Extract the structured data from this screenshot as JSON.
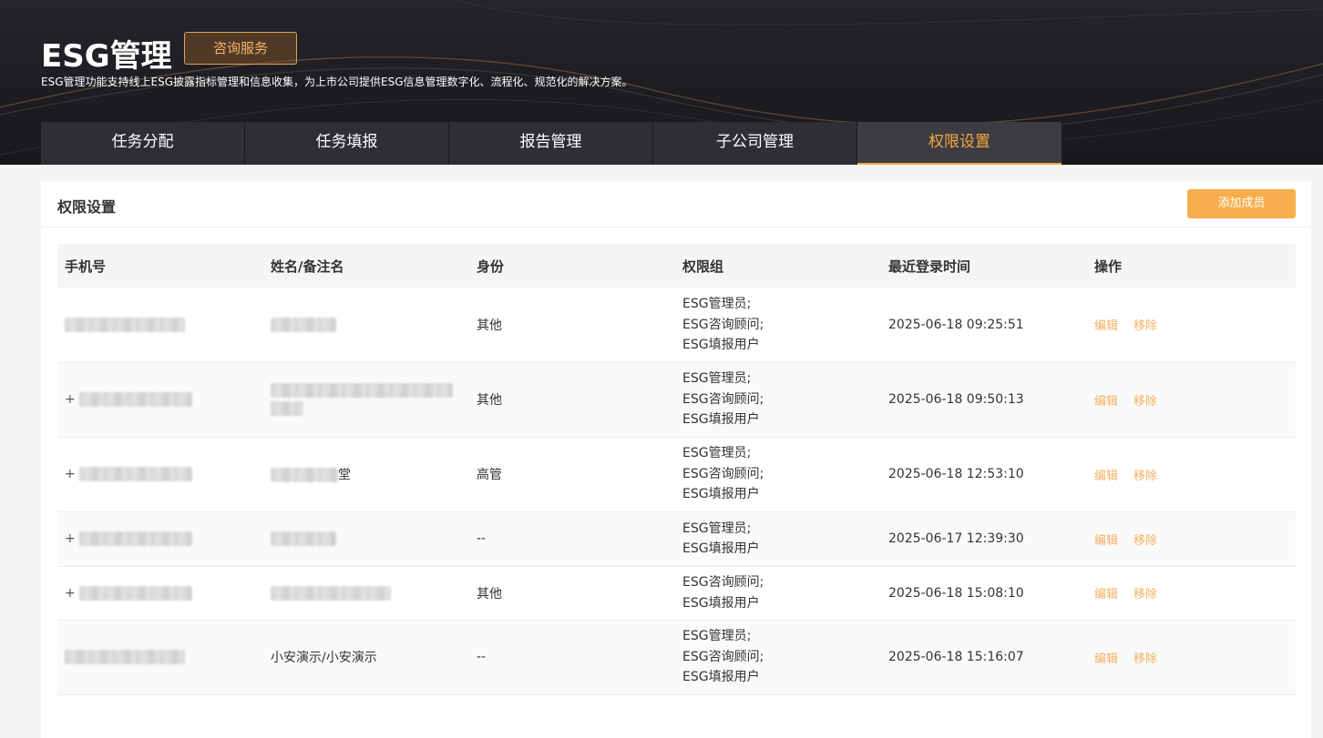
{
  "header": {
    "title": "ESG管理",
    "consult_label": "咨询服务",
    "description": "ESG管理功能支持线上ESG披露指标管理和信息收集，为上市公司提供ESG信息管理数字化、流程化、规范化的解决方案。"
  },
  "tabs": [
    {
      "label": "任务分配",
      "active": false
    },
    {
      "label": "任务填报",
      "active": false
    },
    {
      "label": "报告管理",
      "active": false
    },
    {
      "label": "子公司管理",
      "active": false
    },
    {
      "label": "权限设置",
      "active": true
    }
  ],
  "panel": {
    "title": "权限设置",
    "add_label": "添加成员"
  },
  "table": {
    "columns": [
      "手机号",
      "姓名/备注名",
      "身份",
      "权限组",
      "最近登录时间",
      "操作"
    ],
    "rows": [
      {
        "phone_prefix": "",
        "name": "",
        "name_suffix": "",
        "role": "其他",
        "perms": [
          "ESG管理员;",
          "ESG咨询顾问;",
          "ESG填报用户"
        ],
        "last_login": "2025-06-18 09:25:51"
      },
      {
        "phone_prefix": "+",
        "name": "",
        "name_suffix": "",
        "role": "其他",
        "perms": [
          "ESG管理员;",
          "ESG咨询顾问;",
          "ESG填报用户"
        ],
        "last_login": "2025-06-18 09:50:13"
      },
      {
        "phone_prefix": "+",
        "name": "",
        "name_suffix": "堂",
        "role": "高管",
        "perms": [
          "ESG管理员;",
          "ESG咨询顾问;",
          "ESG填报用户"
        ],
        "last_login": "2025-06-18 12:53:10"
      },
      {
        "phone_prefix": "+",
        "name": "",
        "name_suffix": "",
        "role": "--",
        "perms": [
          "ESG管理员;",
          "ESG填报用户"
        ],
        "last_login": "2025-06-17 12:39:30"
      },
      {
        "phone_prefix": "+",
        "name": "",
        "name_suffix": "",
        "role": "其他",
        "perms": [
          "ESG咨询顾问;",
          "ESG填报用户"
        ],
        "last_login": "2025-06-18 15:08:10"
      },
      {
        "phone_prefix": "",
        "name": "小安演示/小安演示",
        "name_suffix": "",
        "role": "--",
        "perms": [
          "ESG管理员;",
          "ESG咨询顾问;",
          "ESG填报用户"
        ],
        "last_login": "2025-06-18 15:16:07"
      }
    ],
    "actions": {
      "edit": "编辑",
      "remove": "移除"
    }
  },
  "colors": {
    "accent": "#f6a843",
    "button_orange": "#f7ad4b",
    "action_text": "#f4b062",
    "hero_bg": "#1c1c21"
  }
}
